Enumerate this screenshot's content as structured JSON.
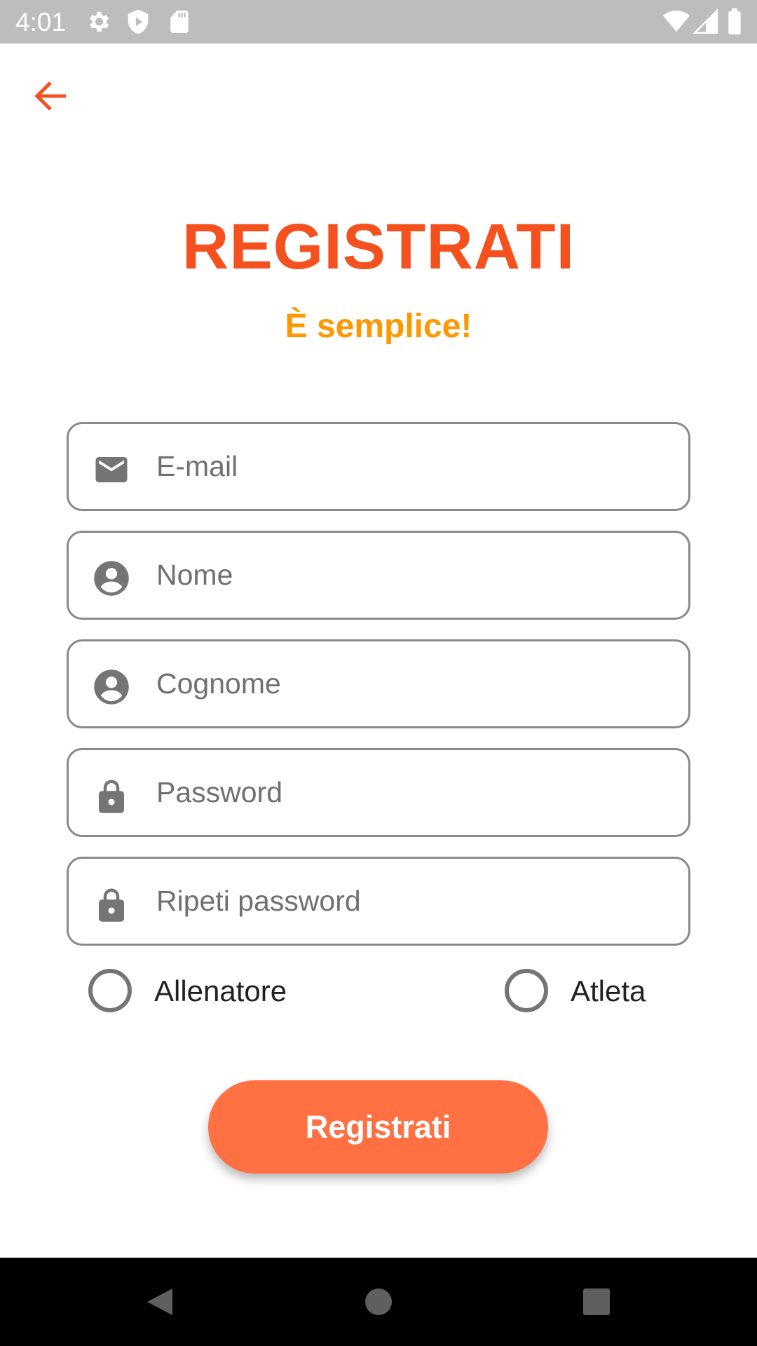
{
  "status_bar": {
    "time": "4:01",
    "icons_left": [
      "settings-icon",
      "shield-icon",
      "sd-card-icon"
    ],
    "icons_right": [
      "wifi-icon",
      "signal-icon",
      "battery-icon"
    ]
  },
  "header": {
    "back_icon": "arrow-left-icon",
    "title": "REGISTRATI",
    "subtitle": "È semplice!"
  },
  "form": {
    "fields": [
      {
        "placeholder": "E-mail",
        "icon": "email-icon"
      },
      {
        "placeholder": "Nome",
        "icon": "account-icon"
      },
      {
        "placeholder": "Cognome",
        "icon": "account-icon"
      },
      {
        "placeholder": "Password",
        "icon": "lock-icon"
      },
      {
        "placeholder": "Ripeti password",
        "icon": "lock-icon"
      }
    ],
    "roles": [
      {
        "label": "Allenatore",
        "selected": false
      },
      {
        "label": "Atleta",
        "selected": false
      }
    ],
    "submit_label": "Registrati"
  },
  "colors": {
    "accent": "#f4511e",
    "subtitle": "#ff9800",
    "button": "#ff7043",
    "status_bar": "#bdbdbd",
    "icon": "#757575"
  },
  "nav_bar": [
    "back-icon",
    "home-icon",
    "recents-icon"
  ]
}
